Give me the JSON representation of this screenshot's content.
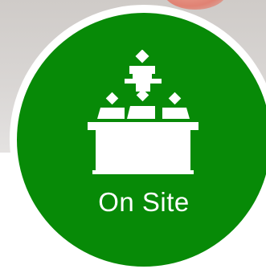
{
  "badge": {
    "label": "On Site",
    "icon": "conference-podium-icon",
    "color": "#078a07"
  }
}
